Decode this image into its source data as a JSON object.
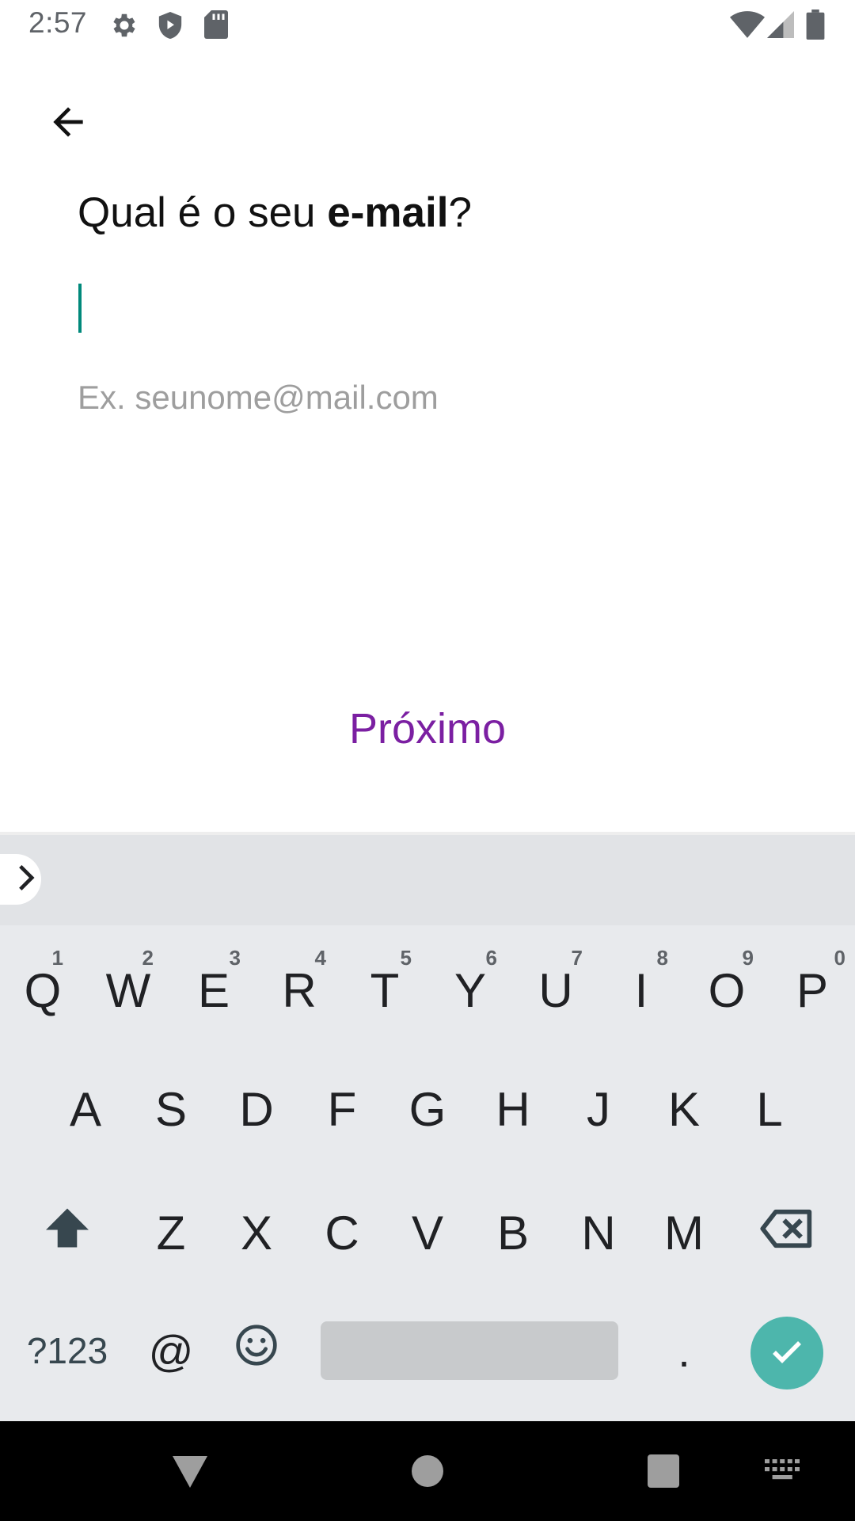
{
  "status_bar": {
    "time": "2:57",
    "left_icons": [
      "settings-icon",
      "shield-icon",
      "sd-card-icon"
    ],
    "right_icons": [
      "wifi-icon",
      "cell-signal-icon",
      "battery-icon"
    ]
  },
  "screen": {
    "back_icon": "arrow-left-icon",
    "question_prefix": "Qual é o seu ",
    "question_bold": "e-mail",
    "question_suffix": "?",
    "email_value": "",
    "example_hint": "Ex. seunome@mail.com",
    "next_label": "Próximo",
    "accent_color": "#7b1fa2",
    "caret_color": "#00897b"
  },
  "keyboard": {
    "row1": [
      {
        "label": "Q",
        "hint": "1"
      },
      {
        "label": "W",
        "hint": "2"
      },
      {
        "label": "E",
        "hint": "3"
      },
      {
        "label": "R",
        "hint": "4"
      },
      {
        "label": "T",
        "hint": "5"
      },
      {
        "label": "Y",
        "hint": "6"
      },
      {
        "label": "U",
        "hint": "7"
      },
      {
        "label": "I",
        "hint": "8"
      },
      {
        "label": "O",
        "hint": "9"
      },
      {
        "label": "P",
        "hint": "0"
      }
    ],
    "row2": [
      "A",
      "S",
      "D",
      "F",
      "G",
      "H",
      "J",
      "K",
      "L"
    ],
    "row3": [
      "Z",
      "X",
      "C",
      "V",
      "B",
      "N",
      "M"
    ],
    "symbols_label": "?123",
    "at_label": "@",
    "period_label": ".",
    "enter_color": "#4db6ac"
  },
  "nav_bar": {
    "icons": [
      "back-triangle-icon",
      "home-circle-icon",
      "recents-square-icon",
      "keyboard-switch-icon"
    ]
  }
}
